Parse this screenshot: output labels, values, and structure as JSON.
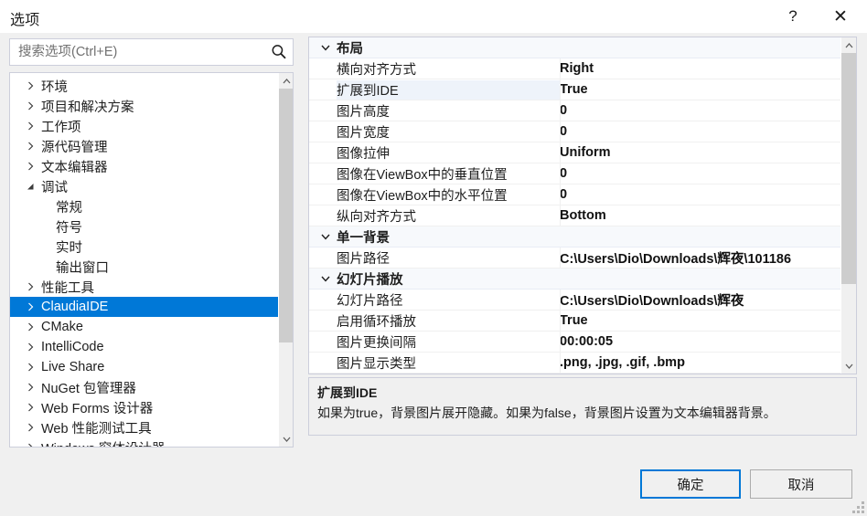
{
  "window": {
    "title": "选项",
    "help_label": "?",
    "close_label": "✕"
  },
  "search": {
    "placeholder": "搜索选项(Ctrl+E)",
    "value": "",
    "icon": "search-icon"
  },
  "tree": {
    "items": [
      {
        "label": "环境",
        "level": 0,
        "expander": "collapsed",
        "selected": false
      },
      {
        "label": "项目和解决方案",
        "level": 0,
        "expander": "collapsed",
        "selected": false
      },
      {
        "label": "工作项",
        "level": 0,
        "expander": "collapsed",
        "selected": false
      },
      {
        "label": "源代码管理",
        "level": 0,
        "expander": "collapsed",
        "selected": false
      },
      {
        "label": "文本编辑器",
        "level": 0,
        "expander": "collapsed",
        "selected": false
      },
      {
        "label": "调试",
        "level": 0,
        "expander": "expanded",
        "selected": false
      },
      {
        "label": "常规",
        "level": 1,
        "expander": "none",
        "selected": false
      },
      {
        "label": "符号",
        "level": 1,
        "expander": "none",
        "selected": false
      },
      {
        "label": "实时",
        "level": 1,
        "expander": "none",
        "selected": false
      },
      {
        "label": "输出窗口",
        "level": 1,
        "expander": "none",
        "selected": false
      },
      {
        "label": "性能工具",
        "level": 0,
        "expander": "collapsed",
        "selected": false
      },
      {
        "label": "ClaudiaIDE",
        "level": 0,
        "expander": "collapsed",
        "selected": true
      },
      {
        "label": "CMake",
        "level": 0,
        "expander": "collapsed",
        "selected": false
      },
      {
        "label": "IntelliCode",
        "level": 0,
        "expander": "collapsed",
        "selected": false
      },
      {
        "label": "Live Share",
        "level": 0,
        "expander": "collapsed",
        "selected": false
      },
      {
        "label": "NuGet 包管理器",
        "level": 0,
        "expander": "collapsed",
        "selected": false
      },
      {
        "label": "Web Forms 设计器",
        "level": 0,
        "expander": "collapsed",
        "selected": false
      },
      {
        "label": "Web 性能测试工具",
        "level": 0,
        "expander": "collapsed",
        "selected": false
      },
      {
        "label": "Windows 窗体设计器",
        "level": 0,
        "expander": "collapsed",
        "selected": false
      }
    ]
  },
  "grid": {
    "rows": [
      {
        "kind": "category",
        "name": "布局",
        "value": "",
        "expander": "expanded",
        "selected": false
      },
      {
        "kind": "property",
        "name": "横向对齐方式",
        "value": "Right",
        "selected": false
      },
      {
        "kind": "property",
        "name": "扩展到IDE",
        "value": "True",
        "selected": true
      },
      {
        "kind": "property",
        "name": "图片高度",
        "value": "0",
        "selected": false
      },
      {
        "kind": "property",
        "name": "图片宽度",
        "value": "0",
        "selected": false
      },
      {
        "kind": "property",
        "name": "图像拉伸",
        "value": "Uniform",
        "selected": false
      },
      {
        "kind": "property",
        "name": "图像在ViewBox中的垂直位置",
        "value": "0",
        "selected": false
      },
      {
        "kind": "property",
        "name": "图像在ViewBox中的水平位置",
        "value": "0",
        "selected": false
      },
      {
        "kind": "property",
        "name": "纵向对齐方式",
        "value": "Bottom",
        "selected": false
      },
      {
        "kind": "category",
        "name": "单一背景",
        "value": "",
        "expander": "expanded",
        "selected": false
      },
      {
        "kind": "property",
        "name": "图片路径",
        "value": "C:\\Users\\Dio\\Downloads\\辉夜\\101186",
        "selected": false
      },
      {
        "kind": "category",
        "name": "幻灯片播放",
        "value": "",
        "expander": "expanded",
        "selected": false
      },
      {
        "kind": "property",
        "name": "幻灯片路径",
        "value": "C:\\Users\\Dio\\Downloads\\辉夜",
        "selected": false
      },
      {
        "kind": "property",
        "name": "启用循环播放",
        "value": "True",
        "selected": false
      },
      {
        "kind": "property",
        "name": "图片更换间隔",
        "value": "00:00:05",
        "selected": false
      },
      {
        "kind": "property",
        "name": "图片显示类型",
        "value": ".png, .jpg, .gif, .bmp",
        "selected": false
      }
    ]
  },
  "description": {
    "title": "扩展到IDE",
    "body": "如果为true，背景图片展开隐藏。如果为false，背景图片设置为文本编辑器背景。"
  },
  "footer": {
    "ok_label": "确定",
    "cancel_label": "取消"
  },
  "colors": {
    "selection_blue": "#0078d7",
    "dialog_bg": "#f0f0f0",
    "panel_border": "#cccedb",
    "scrollbar_thumb": "#cdcdcd"
  }
}
